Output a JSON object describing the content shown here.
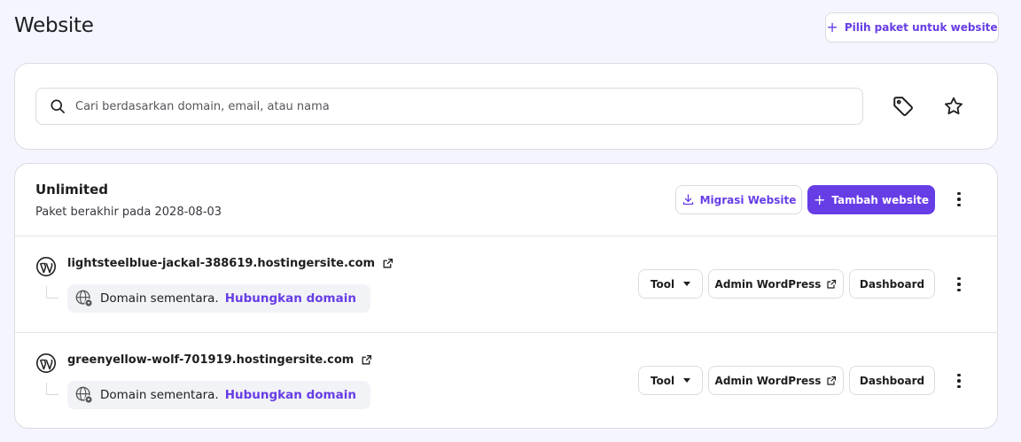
{
  "page": {
    "title": "Website",
    "choose_plan_label": "Pilih paket untuk website"
  },
  "search": {
    "placeholder": "Cari berdasarkan domain, email, atau nama",
    "value": ""
  },
  "icons": {
    "search": "search-icon",
    "tag": "tag-icon",
    "star": "star-icon",
    "wordpress": "wordpress-icon",
    "external_link": "external-link-icon",
    "globe": "globe-icon",
    "download": "download-icon",
    "plus": "plus-icon",
    "caret": "caret-down-icon",
    "more": "more-vertical-icon"
  },
  "colors": {
    "accent": "#673de6",
    "background": "#f4f5ff",
    "card": "#ffffff",
    "border": "#dadce0",
    "text": "#1d1e20"
  },
  "plan": {
    "name": "Unlimited",
    "expiry": "Paket berakhir pada 2028-08-03",
    "migrate_label": "Migrasi Website",
    "add_label": "Tambah website"
  },
  "sites": [
    {
      "domain": "lightsteelblue-jackal-388619.hostingersite.com",
      "temp_label": "Domain sementara.",
      "connect_label": "Hubungkan domain",
      "tool_label": "Tool",
      "admin_label": "Admin WordPress",
      "dashboard_label": "Dashboard"
    },
    {
      "domain": "greenyellow-wolf-701919.hostingersite.com",
      "temp_label": "Domain sementara.",
      "connect_label": "Hubungkan domain",
      "tool_label": "Tool",
      "admin_label": "Admin WordPress",
      "dashboard_label": "Dashboard"
    }
  ]
}
